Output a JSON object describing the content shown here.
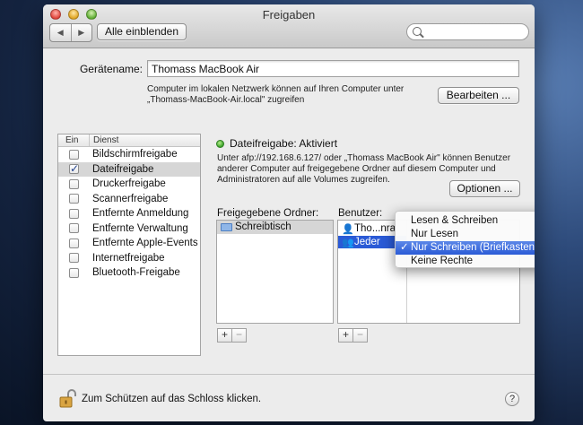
{
  "window": {
    "title": "Freigaben",
    "show_all_label": "Alle einblenden",
    "search_placeholder": ""
  },
  "device": {
    "name_label": "Gerätename:",
    "name_value": "Thomass MacBook Air",
    "info_line1": "Computer im lokalen Netzwerk können auf Ihren Computer unter",
    "info_line2": "„Thomass-MacBook-Air.local\" zugreifen",
    "edit_label": "Bearbeiten ..."
  },
  "services": {
    "col_on": "Ein",
    "col_service": "Dienst",
    "items": [
      {
        "label": "Bildschirmfreigabe",
        "checked": false
      },
      {
        "label": "Dateifreigabe",
        "checked": true
      },
      {
        "label": "Druckerfreigabe",
        "checked": false
      },
      {
        "label": "Scannerfreigabe",
        "checked": false
      },
      {
        "label": "Entfernte Anmeldung",
        "checked": false
      },
      {
        "label": "Entfernte Verwaltung",
        "checked": false
      },
      {
        "label": "Entfernte Apple-Events",
        "checked": false
      },
      {
        "label": "Internetfreigabe",
        "checked": false
      },
      {
        "label": "Bluetooth-Freigabe",
        "checked": false
      }
    ]
  },
  "file_sharing": {
    "status": "Dateifreigabe: Aktiviert",
    "desc_line1": "Unter afp://192.168.6.127/ oder „Thomass MacBook Air\" können Benutzer",
    "desc_line2": "anderer Computer auf freigegebene Ordner auf diesem Computer und",
    "desc_line3": "Administratoren auf alle Volumes zugreifen.",
    "options_label": "Optionen ...",
    "folders_label": "Freigegebene Ordner:",
    "folders": [
      "Schreibtisch"
    ],
    "users_label": "Benutzer:",
    "users": [
      "Tho...nra",
      "Jeder"
    ]
  },
  "permission_menu": {
    "items": [
      "Lesen & Schreiben",
      "Nur Lesen",
      "Nur Schreiben (Briefkasten)",
      "Keine Rechte"
    ],
    "selected": "Nur Schreiben (Briefkasten)",
    "check": "✓"
  },
  "footer": {
    "lock_text": "Zum Schützen auf das Schloss klicken.",
    "help": "?"
  },
  "colors": {
    "status_green": "#3aa02a",
    "menu_highlight": "#2a5ad6",
    "checkbox_blue": "#1f3f8c"
  }
}
